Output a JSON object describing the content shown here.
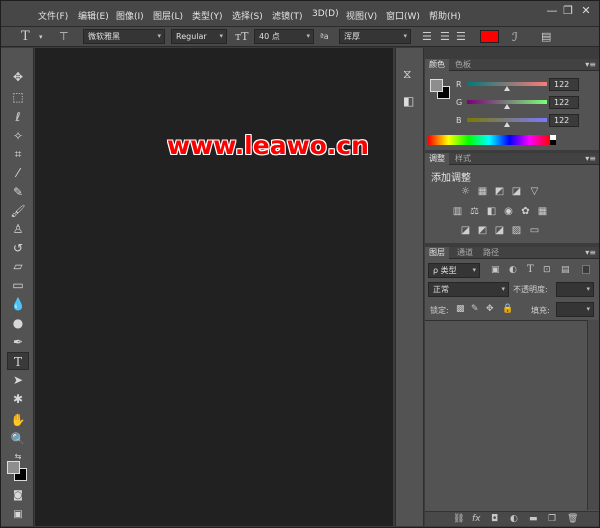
{
  "menu": [
    "文件(F)",
    "编辑(E)",
    "图像(I)",
    "图层(L)",
    "类型(Y)",
    "选择(S)",
    "滤镜(T)",
    "3D(D)",
    "视图(V)",
    "窗口(W)",
    "帮助(H)"
  ],
  "window_controls": {
    "minimize": "—",
    "restore": "❐",
    "close": "✕"
  },
  "options": {
    "font_family": "微软雅黑",
    "font_style": "Regular",
    "font_size": "40 点",
    "antialias_label": "ªa",
    "antialias": "浑厚",
    "text_color": "#ff0000"
  },
  "watermark": "www.leawo.cn",
  "color_panel": {
    "tabs": [
      "颜色",
      "色板"
    ],
    "channels": [
      {
        "label": "R",
        "value": "122"
      },
      {
        "label": "G",
        "value": "122"
      },
      {
        "label": "B",
        "value": "122"
      }
    ]
  },
  "adjust_panel": {
    "tabs": [
      "调整",
      "样式"
    ],
    "heading": "添加调整"
  },
  "layers_panel": {
    "tabs": [
      "图层",
      "通道",
      "路径"
    ],
    "filter_kind": "ρ 类型",
    "blend_mode": "正常",
    "opacity_label": "不透明度:",
    "lock_label": "锁定:",
    "fill_label": "填充:"
  },
  "icons": {
    "tools": [
      "move-icon",
      "marquee-icon",
      "lasso-icon",
      "magic-wand-icon",
      "crop-icon",
      "eyedropper-icon",
      "healing-brush-icon",
      "brush-icon",
      "clone-stamp-icon",
      "history-brush-icon",
      "eraser-icon",
      "gradient-icon",
      "blur-icon",
      "dodge-icon",
      "pen-icon",
      "type-icon",
      "path-selection-icon",
      "shape-icon",
      "hand-icon",
      "zoom-icon"
    ]
  }
}
